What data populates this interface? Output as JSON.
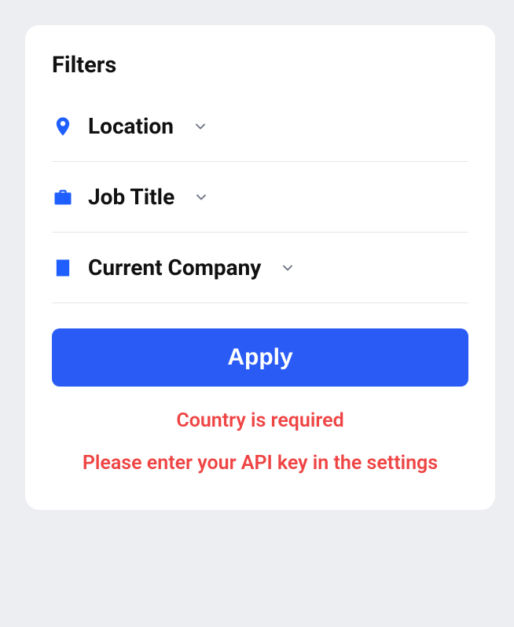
{
  "title": "Filters",
  "filters": {
    "location": {
      "label": "Location",
      "icon": "location-pin-icon"
    },
    "jobTitle": {
      "label": "Job Title",
      "icon": "briefcase-icon"
    },
    "company": {
      "label": "Current Company",
      "icon": "building-icon"
    }
  },
  "actions": {
    "apply_label": "Apply"
  },
  "errors": {
    "country": "Country is required",
    "api_key": "Please enter your API key in the settings"
  },
  "colors": {
    "accent": "#2a5cf5",
    "error": "#ef4444"
  }
}
